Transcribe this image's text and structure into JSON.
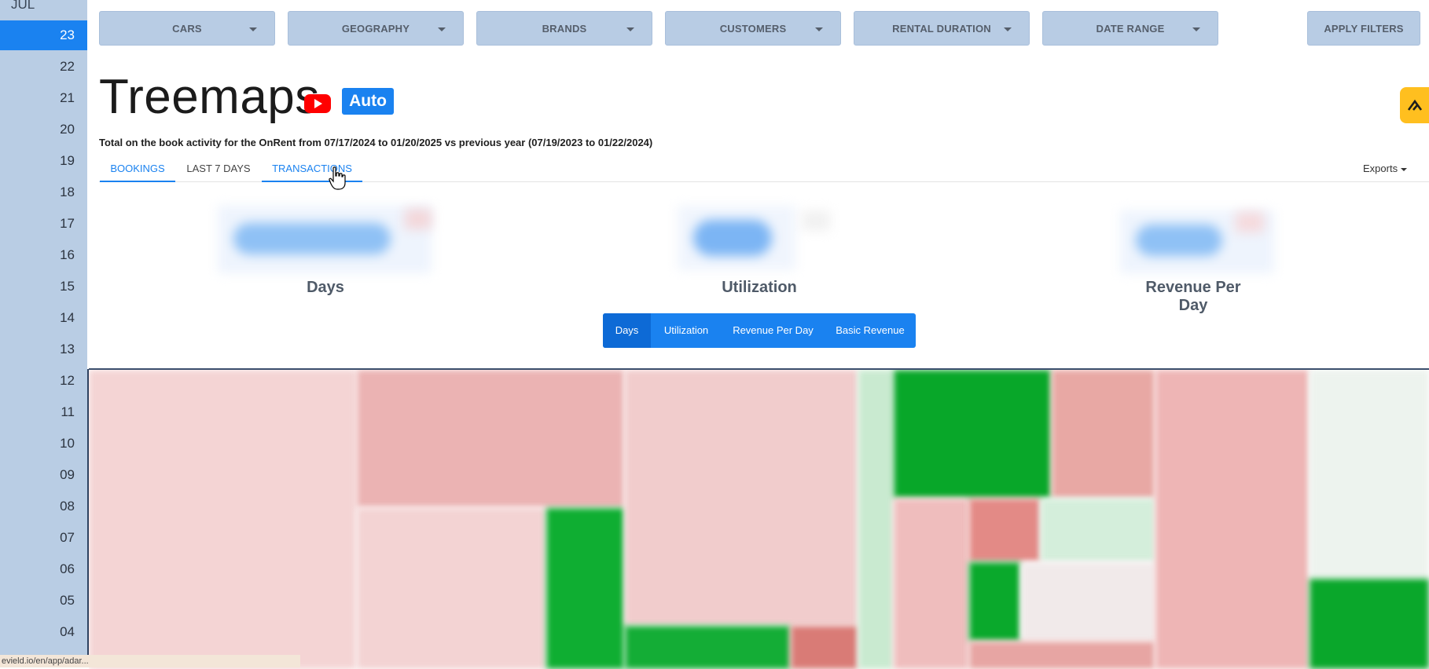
{
  "sidebar": {
    "month": "JUL",
    "days": [
      "23",
      "22",
      "21",
      "20",
      "19",
      "18",
      "17",
      "16",
      "15",
      "14",
      "13",
      "12",
      "11",
      "10",
      "09",
      "08",
      "07",
      "06",
      "05",
      "04"
    ],
    "active_day": "23"
  },
  "filters": {
    "cars": "CARS",
    "geography": "GEOGRAPHY",
    "brands": "BRANDS",
    "customers": "CUSTOMERS",
    "rental_duration": "RENTAL DURATION",
    "date_range": "DATE RANGE",
    "apply": "APPLY FILTERS"
  },
  "header": {
    "title": "Treemaps",
    "badge": "Auto",
    "subtitle": "Total on the book activity for the OnRent from 07/17/2024 to 01/20/2025 vs previous year (07/19/2023 to 01/22/2024)"
  },
  "tabs": {
    "bookings": "BOOKINGS",
    "last7": "LAST 7 DAYS",
    "transactions": "TRANSACTIONS",
    "exports": "Exports"
  },
  "kpis": {
    "days": "Days",
    "utilization": "Utilization",
    "revenue_per_day": "Revenue Per Day"
  },
  "metric_buttons": {
    "days": "Days",
    "utilization": "Utilization",
    "revenue_per_day": "Revenue Per Day",
    "basic_revenue": "Basic Revenue",
    "active": "Days"
  },
  "colors": {
    "accent": "#1a82f0",
    "sidebar_bg": "#b9cde4",
    "filter_bg": "#b8cce4",
    "negative": "#e8a8a4",
    "positive": "#0aa82a",
    "widget": "#ffbf1f"
  },
  "status_bar": "evield.io/en/app/adar..."
}
